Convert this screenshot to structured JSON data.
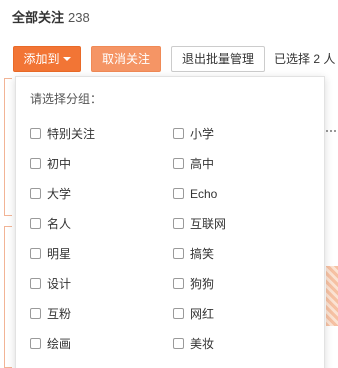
{
  "header": {
    "title": "全部关注",
    "count": "238"
  },
  "toolbar": {
    "add_label": "添加到",
    "cancel_label": "取消关注",
    "exit_label": "退出批量管理",
    "selected_text": "已选择 2 人"
  },
  "dropdown": {
    "prompt": "请选择分组：",
    "options": [
      {
        "label": "特别关注",
        "checked": false
      },
      {
        "label": "小学",
        "checked": false
      },
      {
        "label": "初中",
        "checked": false
      },
      {
        "label": "高中",
        "checked": false
      },
      {
        "label": "大学",
        "checked": false
      },
      {
        "label": "Echo",
        "checked": false
      },
      {
        "label": "名人",
        "checked": false
      },
      {
        "label": "互联网",
        "checked": false
      },
      {
        "label": "明星",
        "checked": false
      },
      {
        "label": "搞笑",
        "checked": false
      },
      {
        "label": "设计",
        "checked": false
      },
      {
        "label": "狗狗",
        "checked": false
      },
      {
        "label": "互粉",
        "checked": false
      },
      {
        "label": "网红",
        "checked": false
      },
      {
        "label": "绘画",
        "checked": false
      },
      {
        "label": "美妆",
        "checked": false
      }
    ]
  },
  "colors": {
    "accent": "#f27535",
    "accent_light": "#f59565"
  }
}
